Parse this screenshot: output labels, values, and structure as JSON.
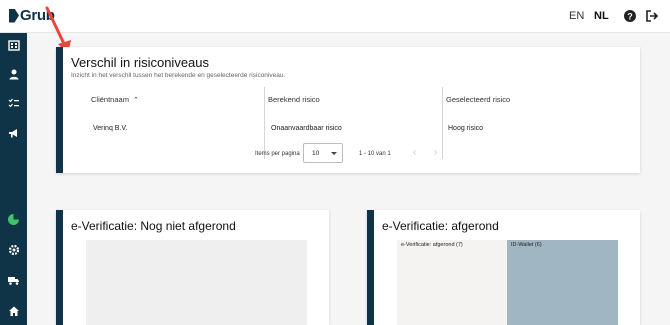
{
  "app": {
    "logo_text": "Grub"
  },
  "header": {
    "lang_en": "EN",
    "lang_nl": "NL",
    "icons": [
      "help-icon",
      "logout-icon"
    ]
  },
  "sidebar": {
    "icons": [
      "building-icon",
      "user-icon",
      "checklist-icon",
      "megaphone-icon",
      "pie-chart-icon",
      "gear-icon",
      "truck-icon",
      "home-icon"
    ]
  },
  "risk_card": {
    "title": "Verschil in risiconiveaus",
    "subtitle": "Inzicht in het verschil tussen het berekende en geselecteerde risiconiveau.",
    "columns": [
      "Cliëntnaam",
      "Berekend risico",
      "Geselecteerd risico"
    ],
    "rows": [
      [
        "Verinq B.V.",
        "Onaanvaardbaar risico",
        "Hoog risico"
      ]
    ],
    "pagination": {
      "items_per_page_label": "Items per pagina",
      "items_per_page_value": "10",
      "range_label": "1 - 10 van 1"
    }
  },
  "everif_open": {
    "title": "e-Verificatie: Nog niet afgerond"
  },
  "everif_done": {
    "title": "e-Verificatie: afgerond",
    "segments": [
      {
        "label": "e-Verificatie: afgerond (7)",
        "value": 7,
        "color": "#f4f3f1"
      },
      {
        "label": "ID-Wallet (6)",
        "value": 6,
        "color": "#a0b6c2"
      }
    ]
  },
  "colors": {
    "accent": "#0f3347",
    "arrow": "#e8473b"
  }
}
